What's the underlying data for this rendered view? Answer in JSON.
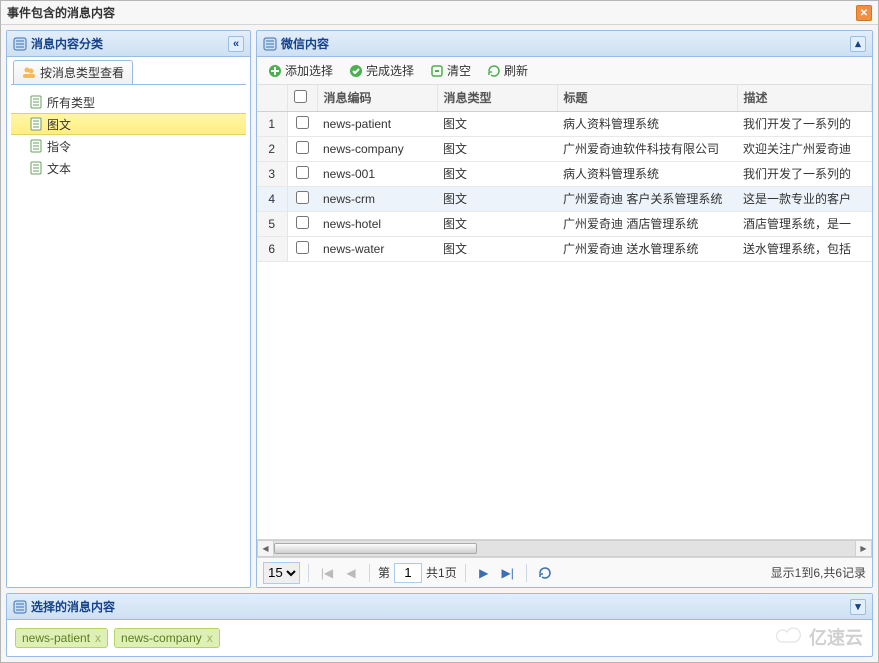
{
  "window": {
    "title": "事件包含的消息内容"
  },
  "leftPanel": {
    "title": "消息内容分类",
    "tab": "按消息类型查看",
    "tree": [
      {
        "label": "所有类型",
        "sel": false
      },
      {
        "label": "图文",
        "sel": true
      },
      {
        "label": "指令",
        "sel": false
      },
      {
        "label": "文本",
        "sel": false
      }
    ]
  },
  "rightPanel": {
    "title": "微信内容",
    "toolbar": {
      "add": "添加选择",
      "done": "完成选择",
      "clear": "清空",
      "refresh": "刷新"
    },
    "cols": {
      "code": "消息编码",
      "type": "消息类型",
      "title": "标题",
      "desc": "描述"
    },
    "rows": [
      {
        "n": "1",
        "code": "news-patient",
        "type": "图文",
        "title": "病人资料管理系统",
        "desc": "我们开发了一系列的"
      },
      {
        "n": "2",
        "code": "news-company",
        "type": "图文",
        "title": "广州爱奇迪软件科技有限公司",
        "desc": "欢迎关注广州爱奇迪"
      },
      {
        "n": "3",
        "code": "news-001",
        "type": "图文",
        "title": "病人资料管理系统",
        "desc": "我们开发了一系列的"
      },
      {
        "n": "4",
        "code": "news-crm",
        "type": "图文",
        "title": "广州爱奇迪 客户关系管理系统",
        "desc": "这是一款专业的客户",
        "hl": true
      },
      {
        "n": "5",
        "code": "news-hotel",
        "type": "图文",
        "title": "广州爱奇迪 酒店管理系统",
        "desc": "酒店管理系统，是一"
      },
      {
        "n": "6",
        "code": "news-water",
        "type": "图文",
        "title": "广州爱奇迪 送水管理系统",
        "desc": "送水管理系统，包括"
      }
    ]
  },
  "pager": {
    "size": "15",
    "page_label_prefix": "第",
    "page": "1",
    "total_pages": "共1页",
    "summary": "显示1到6,共6记录"
  },
  "bottomPanel": {
    "title": "选择的消息内容",
    "tags": [
      "news-patient",
      "news-company"
    ]
  },
  "watermark": "亿速云"
}
